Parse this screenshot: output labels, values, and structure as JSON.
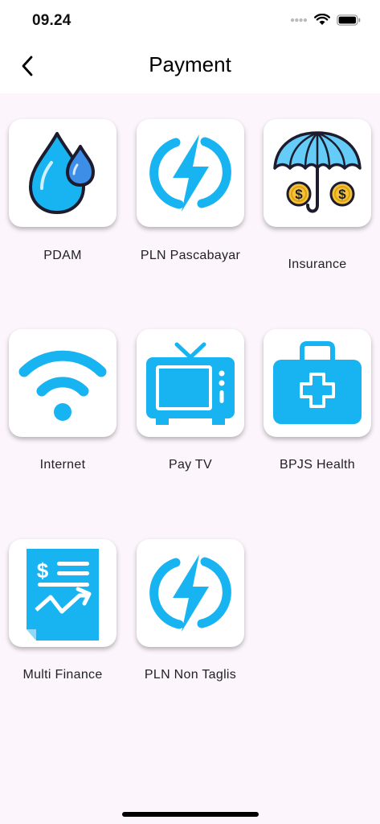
{
  "status": {
    "time": "09.24"
  },
  "header": {
    "title": "Payment"
  },
  "items": [
    {
      "label": "PDAM",
      "icon": "water-drop-icon"
    },
    {
      "label": "PLN Pascabayar",
      "icon": "lightning-icon"
    },
    {
      "label": "Insurance",
      "icon": "umbrella-coins-icon"
    },
    {
      "label": "Internet",
      "icon": "wifi-icon"
    },
    {
      "label": "Pay TV",
      "icon": "tv-icon"
    },
    {
      "label": "BPJS Health",
      "icon": "medical-kit-icon"
    },
    {
      "label": "Multi Finance",
      "icon": "finance-document-icon"
    },
    {
      "label": "PLN Non Taglis",
      "icon": "lightning-icon"
    }
  ],
  "colors": {
    "accent": "#18b4f2",
    "background": "#fcf5fc",
    "coin": "#f5c33b"
  }
}
